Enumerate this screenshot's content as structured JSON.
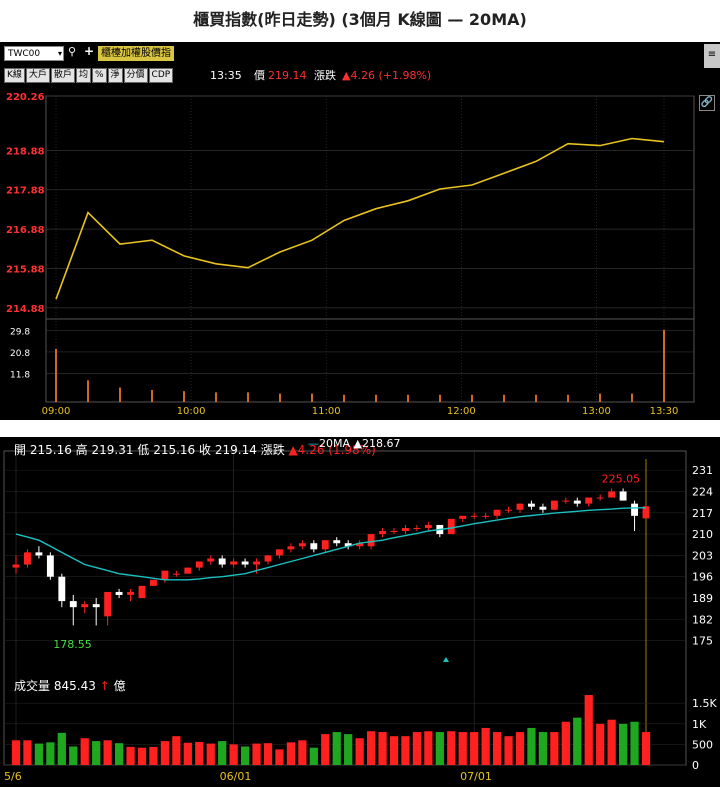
{
  "page_title": "櫃買指數(昨日走勢) (3個月 K線圖 — 20MA)",
  "intraday_panel": {
    "symbol": "TWC00",
    "index_tab": "櫃檯加權股價指",
    "buttons": [
      "K線",
      "大戶",
      "散戶",
      "均",
      "%",
      "淨",
      "分價",
      "CDP"
    ],
    "time": "13:35",
    "price_label": "價",
    "price": "219.14",
    "change_label": "漲跌",
    "change": "▲4.26 (+1.98%)",
    "icons": [
      "search-icon",
      "add-icon",
      "link-icon"
    ],
    "colors": {
      "price_line": "#e8c21e",
      "volume": "#d2691e",
      "red": "#ff3030"
    }
  },
  "kline_panel": {
    "info": {
      "open_label": "開",
      "open": "215.16",
      "high_label": "高",
      "high": "219.31",
      "low_label": "低",
      "low": "215.16",
      "close_label": "收",
      "close": "219.14",
      "change_label": "漲跌",
      "change": "▲4.26 (1.98%)"
    },
    "ma_legend": {
      "name": "20MA",
      "value": "▲218.67"
    },
    "volume": {
      "label": "成交量",
      "value": "845.43",
      "unit": "億"
    },
    "max_annotation": "225.05",
    "min_annotation": "178.55",
    "colors": {
      "up": "#ff2020",
      "down": "#ffffff",
      "ma": "#1ac1c1",
      "vol_up": "#ff2020",
      "vol_down": "#1fa81f"
    }
  },
  "chart_data": [
    {
      "type": "line",
      "y_ticks": [
        "220.26",
        "218.88",
        "217.88",
        "216.88",
        "215.88",
        "214.88"
      ],
      "ylim": [
        214.7,
        220.26
      ],
      "x_ticks": [
        "09:00",
        "10:00",
        "11:00",
        "12:00",
        "13:00",
        "13:30"
      ],
      "x_minutes": [
        0,
        15,
        30,
        45,
        60,
        75,
        90,
        105,
        120,
        135,
        150,
        165,
        180,
        195,
        210,
        225,
        240,
        255,
        270,
        285
      ],
      "price": [
        215.1,
        217.3,
        216.5,
        216.6,
        216.2,
        216.0,
        215.9,
        216.3,
        216.6,
        217.1,
        217.4,
        217.6,
        217.9,
        218.0,
        218.3,
        218.6,
        219.05,
        219.0,
        219.18,
        219.1
      ],
      "volume_ticks": [
        "29.8",
        "20.8",
        "11.8"
      ],
      "volume_ylim": [
        0,
        32
      ],
      "volume": [
        22,
        9,
        6,
        5,
        4.5,
        4,
        4,
        3.5,
        3.5,
        3,
        3,
        3,
        3,
        3,
        3,
        3,
        3,
        3.5,
        3.5,
        30
      ]
    },
    {
      "type": "candlestick",
      "x_ticks": [
        "5/6",
        "06/01",
        "07/01"
      ],
      "y_ticks": [
        "231",
        "224",
        "217",
        "210",
        "203",
        "196",
        "189",
        "182",
        "175"
      ],
      "ylim": [
        168,
        234
      ],
      "ohlc": [
        [
          199,
          203,
          197,
          200
        ],
        [
          200,
          205,
          199,
          204
        ],
        [
          204,
          206,
          202,
          203
        ],
        [
          203,
          204,
          195,
          196
        ],
        [
          196,
          197,
          186,
          188
        ],
        [
          188,
          190,
          180,
          186
        ],
        [
          186,
          188,
          184,
          187
        ],
        [
          187,
          189,
          180,
          186
        ],
        [
          183,
          191,
          180,
          191
        ],
        [
          191,
          192,
          189,
          190
        ],
        [
          190,
          192,
          188,
          191
        ],
        [
          189,
          193,
          189,
          193
        ],
        [
          193,
          195,
          193,
          195
        ],
        [
          195,
          198,
          194,
          198
        ],
        [
          197,
          198,
          196,
          197
        ],
        [
          197,
          199,
          197,
          199
        ],
        [
          199,
          201,
          198,
          201
        ],
        [
          201,
          203,
          200,
          202
        ],
        [
          202,
          203,
          199,
          200
        ],
        [
          200,
          202,
          199,
          201
        ],
        [
          201,
          202,
          199,
          200
        ],
        [
          200,
          202,
          197,
          201
        ],
        [
          201,
          203,
          200,
          203
        ],
        [
          203,
          205,
          202,
          205
        ],
        [
          205,
          207,
          204,
          206
        ],
        [
          206,
          208,
          205,
          207
        ],
        [
          207,
          208,
          204,
          205
        ],
        [
          205,
          208,
          204,
          208
        ],
        [
          208,
          209,
          206,
          207
        ],
        [
          207,
          208,
          205,
          206
        ],
        [
          206,
          208,
          205,
          207
        ],
        [
          206,
          210,
          205,
          210
        ],
        [
          210,
          212,
          209,
          211
        ],
        [
          211,
          212,
          210,
          211
        ],
        [
          211,
          213,
          210,
          212
        ],
        [
          212,
          213,
          211,
          212
        ],
        [
          212,
          214,
          211,
          213
        ],
        [
          213,
          213,
          209,
          210
        ],
        [
          210,
          215,
          210,
          215
        ],
        [
          215,
          216,
          214,
          216
        ],
        [
          216,
          217,
          215,
          216
        ],
        [
          216,
          217,
          215,
          216
        ],
        [
          216,
          218,
          215,
          218
        ],
        [
          218,
          219,
          217,
          218
        ],
        [
          218,
          220,
          217,
          220
        ],
        [
          220,
          221,
          218,
          219
        ],
        [
          219,
          220,
          217,
          218
        ],
        [
          218,
          221,
          218,
          221
        ],
        [
          221,
          222,
          220,
          221
        ],
        [
          221,
          222,
          219,
          220
        ],
        [
          220,
          222,
          219,
          222
        ],
        [
          222,
          223,
          221,
          222
        ],
        [
          222,
          225,
          222,
          224
        ],
        [
          224,
          225,
          221,
          221
        ],
        [
          220,
          221,
          211,
          216
        ],
        [
          215.16,
          219.31,
          215.16,
          219.14
        ]
      ],
      "ma20": [
        210,
        209,
        208,
        206,
        204,
        202,
        200,
        199,
        198,
        197,
        196.5,
        196,
        195.5,
        195,
        195,
        195,
        195.3,
        195.7,
        196,
        196.5,
        197,
        198,
        199,
        200,
        201,
        202,
        203,
        204,
        205,
        206,
        207,
        207.5,
        208,
        208.8,
        209.5,
        210.2,
        211,
        211.5,
        212,
        212.7,
        213.4,
        214,
        214.6,
        215.2,
        215.7,
        216.1,
        216.5,
        216.9,
        217.2,
        217.5,
        217.8,
        218,
        218.2,
        218.5,
        218.6,
        218.67
      ],
      "volume_ticks": [
        "1.5K",
        "1K",
        "500",
        "0"
      ],
      "volume_ylim": [
        0,
        1700
      ],
      "volume": [
        600,
        600,
        520,
        550,
        780,
        450,
        650,
        580,
        600,
        530,
        440,
        420,
        440,
        580,
        700,
        540,
        560,
        520,
        580,
        500,
        450,
        520,
        530,
        380,
        550,
        600,
        420,
        750,
        800,
        750,
        650,
        820,
        800,
        700,
        700,
        800,
        820,
        800,
        820,
        800,
        800,
        900,
        800,
        700,
        800,
        900,
        800,
        800,
        1050,
        1150,
        1700,
        1000,
        1100,
        1000,
        1050,
        800
      ]
    }
  ]
}
